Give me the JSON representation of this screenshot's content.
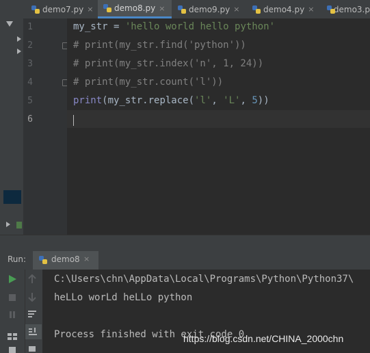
{
  "tabs": [
    {
      "label": "demo7.py",
      "active": false
    },
    {
      "label": "demo8.py",
      "active": true
    },
    {
      "label": "demo9.py",
      "active": false
    },
    {
      "label": "demo4.py",
      "active": false
    },
    {
      "label": "demo3.p",
      "active": false
    }
  ],
  "tab_close_glyph": "×",
  "editor": {
    "line_numbers": [
      "1",
      "2",
      "3",
      "4",
      "5",
      "6"
    ],
    "lines": [
      {
        "var": "my_str",
        "eq": " = ",
        "str": "'hello world hello python'"
      },
      {
        "comment": "# print(my_str.find('python'))"
      },
      {
        "comment": "# print(my_str.index('n', 1, 24))"
      },
      {
        "comment": "# print(my_str.count('l'))"
      },
      {
        "fn": "print",
        "p1": "(my_str.replace(",
        "s1": "'l'",
        "c1": ", ",
        "s2": "'L'",
        "c2": ", ",
        "n": "5",
        "p2": "))"
      },
      {}
    ]
  },
  "run": {
    "label": "Run:",
    "tab": "demo8",
    "close": "×",
    "output": [
      "C:\\Users\\chn\\AppData\\Local\\Programs\\Python\\Python37\\",
      "heLLo worLd heLLo python",
      "",
      "Process finished with exit code 0"
    ]
  },
  "watermark": "https://blog.csdn.net/CHINA_2000chn",
  "colors": {
    "accent": "#4a88c7",
    "run_green": "#499c54",
    "string": "#6a8759",
    "number": "#6897bb",
    "comment": "#808080"
  }
}
